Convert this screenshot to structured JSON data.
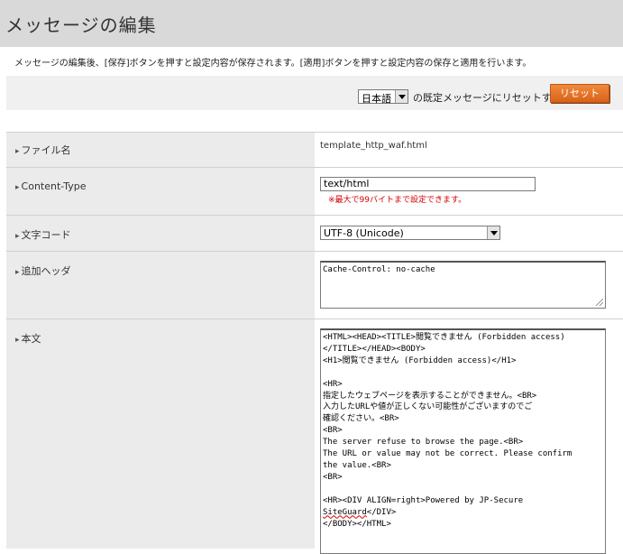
{
  "page": {
    "title": "メッセージの編集",
    "description": "メッセージの編集後、[保存]ボタンを押すと設定内容が保存されます。[適用]ボタンを押すと設定内容の保存と適用を行います。"
  },
  "reset": {
    "language": "日本語",
    "label": "の既定メッセージにリセットする",
    "button": "リセット"
  },
  "fields": {
    "filename_label": "ファイル名",
    "filename_value": "template_http_waf.html",
    "content_type_label": "Content-Type",
    "content_type_value": "text/html",
    "content_type_note": "※最大で99バイトまで設定できます。",
    "charset_label": "文字コード",
    "charset_value": "UTF-8 (Unicode)",
    "header_label": "追加ヘッダ",
    "header_value": "Cache-Control: no-cache",
    "body_label": "本文",
    "body_lines": [
      "<HTML><HEAD><TITLE>閲覧できません (Forbidden access)",
      "</TITLE></HEAD><BODY>",
      "<H1>閲覧できません (Forbidden access)</H1>",
      "",
      "<HR>",
      "指定したウェブページを表示することができません。<BR>",
      "入力したURLや値が正しくない可能性がございますのでご",
      "確認ください。<BR>",
      "<BR>",
      "The server refuse to browse the page.<BR>",
      "The URL or value may not be correct. Please confirm",
      "the value.<BR>",
      "<BR>",
      "",
      "<HR><DIV ALIGN=right>Powered by JP-Secure",
      "SiteGuard</DIV>",
      "</BODY></HTML>"
    ]
  }
}
